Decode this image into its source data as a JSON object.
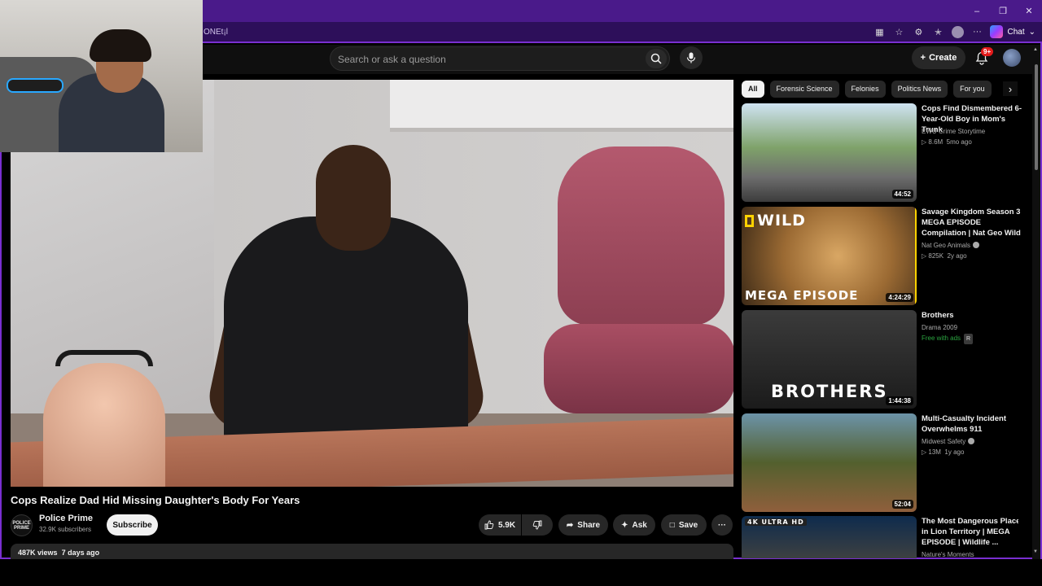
{
  "browser": {
    "url_fragment": "ONEt¡l",
    "window_controls": {
      "minimize": "–",
      "restore": "❐",
      "close": "✕"
    },
    "toolbar_icons": [
      "app-icon",
      "star-icon",
      "extension-icon",
      "favorites-icon",
      "profile-icon",
      "more-icon"
    ],
    "more_label": "···",
    "chat_label": "Chat",
    "accent_color": "#7a2fd1"
  },
  "header": {
    "search_placeholder": "Search or ask a question",
    "create_label": "Create",
    "notification_badge": "9+"
  },
  "video": {
    "title": "Cops Realize Dad Hid Missing Daughter's Body For Years",
    "channel": {
      "name": "Police Prime",
      "logo_text": "POLICE PRIME",
      "subscribers": "32.9K subscribers"
    },
    "subscribe_label": "Subscribe",
    "actions": {
      "likes": "5.9K",
      "share": "Share",
      "ask": "Ask",
      "save": "Save",
      "more": "···"
    },
    "views": "487K views",
    "age": "7 days ago"
  },
  "chips": [
    "All",
    "Forensic Science",
    "Felonies",
    "Politics News",
    "For you"
  ],
  "recommendations": [
    {
      "title": "Cops Find Dismembered 6-Year-Old Boy in Mom's Trunk",
      "channel": "EWU Crime Storytime",
      "views": "8.6M",
      "age": "5mo ago",
      "duration": "44:52"
    },
    {
      "title": "Savage Kingdom Season 3 MEGA EPISODE Compilation | Nat Geo Wild",
      "channel": "Nat Geo Animals",
      "views": "825K",
      "age": "2y ago",
      "duration": "4:24:29",
      "thumb_top_text": "WILD",
      "thumb_bottom_text": "MEGA EPISODE"
    },
    {
      "title": "Brothers",
      "channel": "Drama 2009",
      "badge": "Free with ads",
      "rating": "R",
      "duration": "1:44:38",
      "thumb_text": "BROTHERS"
    },
    {
      "title": "Multi-Casualty Incident Overwhelms 911",
      "channel": "Midwest Safety",
      "views": "13M",
      "age": "1y ago",
      "duration": "52:04"
    },
    {
      "title": "The Most Dangerous Place in Lion Territory | MEGA EPISODE | Wildlife ...",
      "channel": "Nature's Moments",
      "thumb_text": "4K ULTRA HD"
    }
  ]
}
